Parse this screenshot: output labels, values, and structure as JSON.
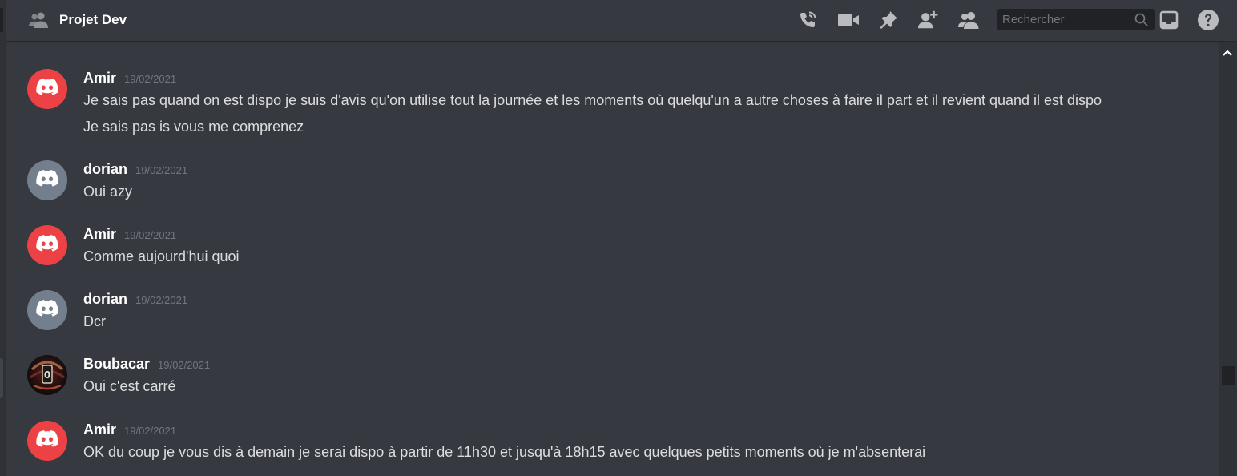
{
  "header": {
    "channel_icon": "people-icon",
    "title": "Projet Dev",
    "icons": [
      "phone-call-icon",
      "video-camera-icon",
      "pin-icon",
      "add-member-icon",
      "member-list-icon",
      "inbox-icon",
      "help-icon"
    ],
    "search": {
      "placeholder": "Rechercher",
      "value": ""
    }
  },
  "messages": [
    {
      "author": "Amir",
      "timestamp": "19/02/2021",
      "avatar": "discord-logo-red",
      "lines": [
        "Je sais pas quand on est dispo je suis d'avis qu'on utilise tout la journée et les moments où quelqu'un a autre choses à faire il part et il revient quand il est dispo",
        "Je sais pas is vous me comprenez"
      ]
    },
    {
      "author": "dorian",
      "timestamp": "19/02/2021",
      "avatar": "discord-logo-grey",
      "lines": [
        "Oui azy"
      ]
    },
    {
      "author": "Amir",
      "timestamp": "19/02/2021",
      "avatar": "discord-logo-red",
      "lines": [
        "Comme aujourd'hui quoi"
      ]
    },
    {
      "author": "dorian",
      "timestamp": "19/02/2021",
      "avatar": "discord-logo-grey",
      "lines": [
        "Dcr"
      ]
    },
    {
      "author": "Boubacar",
      "timestamp": "19/02/2021",
      "avatar": "profile-photo",
      "lines": [
        "Oui c'est carré"
      ]
    },
    {
      "author": "Amir",
      "timestamp": "19/02/2021",
      "avatar": "discord-logo-red",
      "lines": [
        "OK du coup je vous dis à demain je serai dispo à partir de 11h30 et jusqu'à 18h15 avec quelques petits moments où je m'absenterai"
      ]
    }
  ],
  "colors": {
    "background": "#36393f",
    "header_text": "#ffffff",
    "message_text": "#dcddde",
    "timestamp": "#72767d",
    "icon": "#b9bbbe",
    "avatar_red": "#ed4245",
    "avatar_grey": "#747f8d",
    "search_bg": "#202225"
  }
}
